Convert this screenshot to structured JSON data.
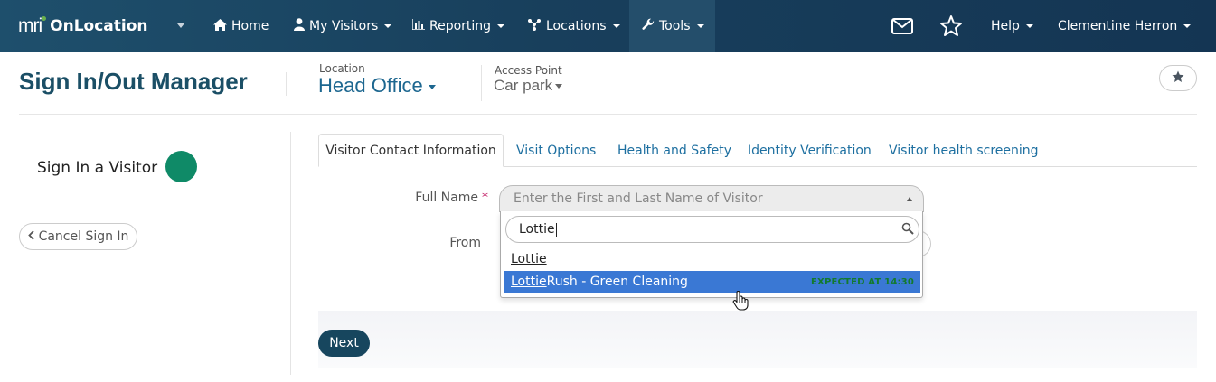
{
  "app": {
    "logo_text": "mri",
    "name": "OnLocation"
  },
  "nav": {
    "home": "Home",
    "my_visitors": "My Visitors",
    "reporting": "Reporting",
    "locations": "Locations",
    "tools": "Tools",
    "help": "Help",
    "user": "Clementine Herron"
  },
  "header": {
    "title": "Sign In/Out Manager",
    "location_label": "Location",
    "location_value": "Head Office",
    "access_point_label": "Access Point",
    "access_point_value": "Car park"
  },
  "left": {
    "title": "Sign In a Visitor",
    "cancel": "Cancel Sign In"
  },
  "tabs": [
    {
      "label": "Visitor Contact Information"
    },
    {
      "label": "Visit Options"
    },
    {
      "label": "Health and Safety"
    },
    {
      "label": "Identity Verification"
    },
    {
      "label": "Visitor health screening"
    }
  ],
  "form": {
    "full_name_label": "Full Name",
    "required_mark": "*",
    "full_name_placeholder": "Enter the First and Last Name of Visitor",
    "from_label": "From",
    "search_value": "Lottie",
    "options": [
      {
        "match": "Lottie",
        "rest": "",
        "status": ""
      },
      {
        "match": "Lottie",
        "rest": " Rush - Green Cleaning",
        "status": "EXPECTED AT 14:30"
      }
    ]
  },
  "actions": {
    "next": "Next"
  },
  "colors": {
    "nav_bg": "#183f5c",
    "title": "#1b4f66",
    "link": "#1d6fa0",
    "highlight": "#3a78d4",
    "status_ok": "#0f8a67",
    "expected": "#127a2d"
  }
}
